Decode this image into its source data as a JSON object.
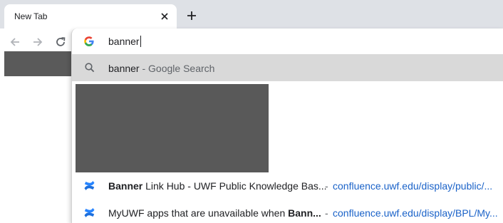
{
  "tab": {
    "title": "New Tab",
    "close_icon": "close-icon",
    "new_tab_icon": "plus-icon"
  },
  "toolbar": {
    "back_icon": "arrow-left-icon",
    "forward_icon": "arrow-right-icon",
    "reload_icon": "reload-icon"
  },
  "omnibox": {
    "engine_icon": "google-g-icon",
    "input_value": "banner"
  },
  "suggestions": {
    "search": {
      "icon": "search-icon",
      "query": "banner",
      "separator": " - ",
      "description": "Google Search"
    },
    "items": [
      {
        "icon": "confluence-icon",
        "title_bold": "Banner",
        "title_rest": " Link Hub - UWF Public Knowledge Bas...",
        "separator": "-",
        "url": "confluence.uwf.edu/display/public/..."
      },
      {
        "icon": "confluence-icon",
        "title_prefix": "MyUWF apps that are unavailable when ",
        "title_bold": "Bann...",
        "separator": "-",
        "url": "confluence.uwf.edu/display/BPL/My..."
      }
    ]
  },
  "colors": {
    "tabstrip_bg": "#dee1e6",
    "selected_suggestion_bg": "#d9d9d9",
    "url_blue": "#1a62c8",
    "redaction_gray": "#595959"
  }
}
